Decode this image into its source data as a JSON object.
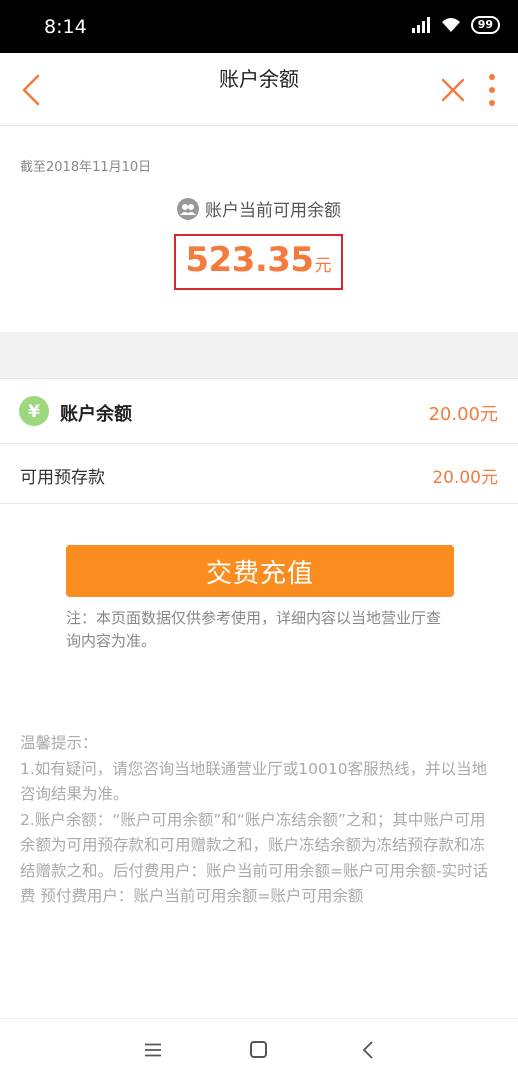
{
  "status_bar": {
    "time": "8:14",
    "battery": "99",
    "icons": [
      "signal-icon",
      "wifi-icon",
      "battery-icon"
    ]
  },
  "nav": {
    "title": "账户余额",
    "back_icon": "chevron-left-icon",
    "close_icon": "close-icon",
    "more_icon": "more-vertical-icon"
  },
  "summary": {
    "as_of": "截至2018年11月10日",
    "available_label": "账户当前可用余额",
    "amount": "523.35",
    "unit": "元"
  },
  "balance": {
    "label": "账户余额",
    "value": "20.00元",
    "icon": "yuan-icon"
  },
  "prepay": {
    "label": "可用预存款",
    "value": "20.00元"
  },
  "actions": {
    "pay_label": "交费充值"
  },
  "note": "注：本页面数据仅供参考使用，详细内容以当地营业厅查询内容为准。",
  "tips": {
    "title": "温馨提示：",
    "line1": "1.如有疑问，请您咨询当地联通营业厅或10010客服热线，并以当地咨询结果为准。",
    "line2": "2.账户余额：“账户可用余额”和“账户冻结余额”之和；其中账户可用余额为可用预存款和可用赠款之和，账户冻结余额为冻结预存款和冻结赠款之和。后付费用户：账户当前可用余额=账户可用余额-实时话费 预付费用户：账户当前可用余额=账户可用余额"
  },
  "colors": {
    "accent": "#f47b3e",
    "button": "#fb8c1f",
    "highlight_border": "#d9282d",
    "yuan_icon": "#9ed87e"
  }
}
